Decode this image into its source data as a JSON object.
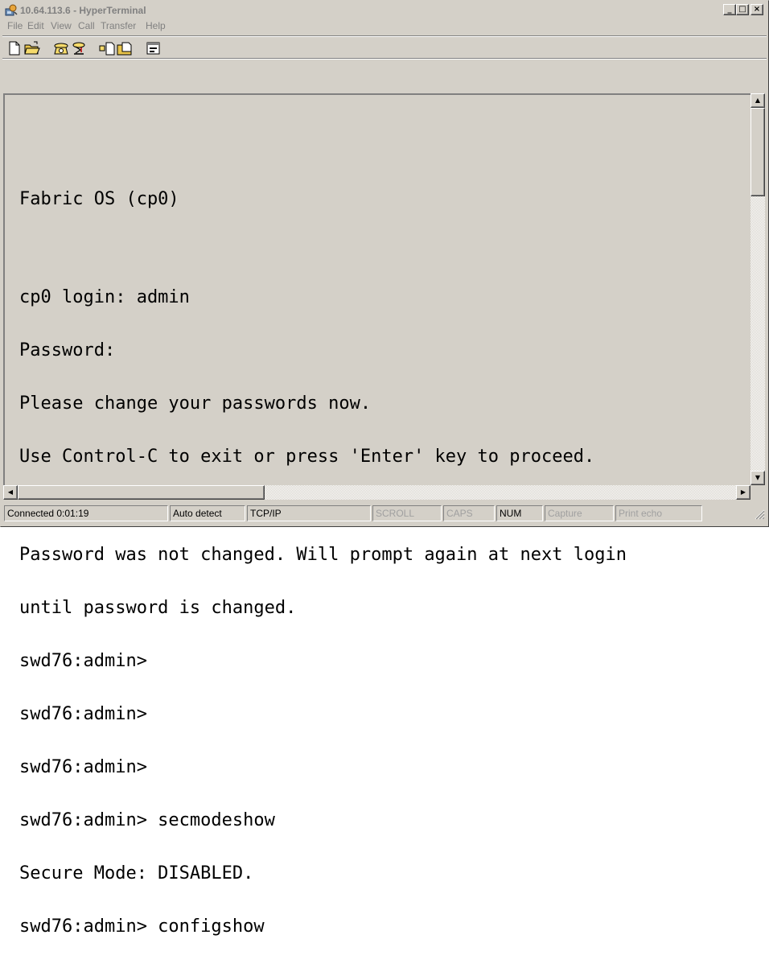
{
  "window": {
    "title": "10.64.113.6 - HyperTerminal",
    "icon": "hyperterminal-app-icon",
    "controls": {
      "minimize": "_",
      "maximize": "□",
      "close": "×"
    }
  },
  "menu": {
    "items": [
      "File",
      "Edit",
      "View",
      "Call",
      "Transfer",
      "Help"
    ]
  },
  "toolbar": {
    "buttons": [
      {
        "icon": "new-document-icon"
      },
      {
        "icon": "open-folder-icon"
      },
      {
        "icon": "call-phone-icon"
      },
      {
        "icon": "disconnect-phone-icon"
      },
      {
        "icon": "send-file-icon"
      },
      {
        "icon": "receive-file-icon"
      },
      {
        "icon": "properties-icon"
      }
    ]
  },
  "terminal": {
    "lines": [
      "Fabric OS (cp0)",
      "",
      "cp0 login: admin",
      "Password:",
      "Please change your passwords now.",
      "Use Control-C to exit or press 'Enter' key to proceed.",
      "",
      "Password was not changed. Will prompt again at next login",
      "until password is changed.",
      "swd76:admin>",
      "swd76:admin>",
      "swd76:admin>",
      "swd76:admin> secmodeshow",
      "Secure Mode: DISABLED.",
      "swd76:admin> configshow"
    ]
  },
  "scrollbars": {
    "up_arrow": "▲",
    "down_arrow": "▼",
    "left_arrow": "◀",
    "right_arrow": "▶"
  },
  "status": {
    "connected": "Connected 0:01:19",
    "detect": "Auto detect",
    "protocol": "TCP/IP",
    "scroll": "SCROLL",
    "caps": "CAPS",
    "num": "NUM",
    "capture": "Capture",
    "print_echo": "Print echo"
  },
  "colors": {
    "chrome": "#d4d0c8",
    "inactive_title_text": "#808080",
    "terminal_text": "#000000"
  }
}
